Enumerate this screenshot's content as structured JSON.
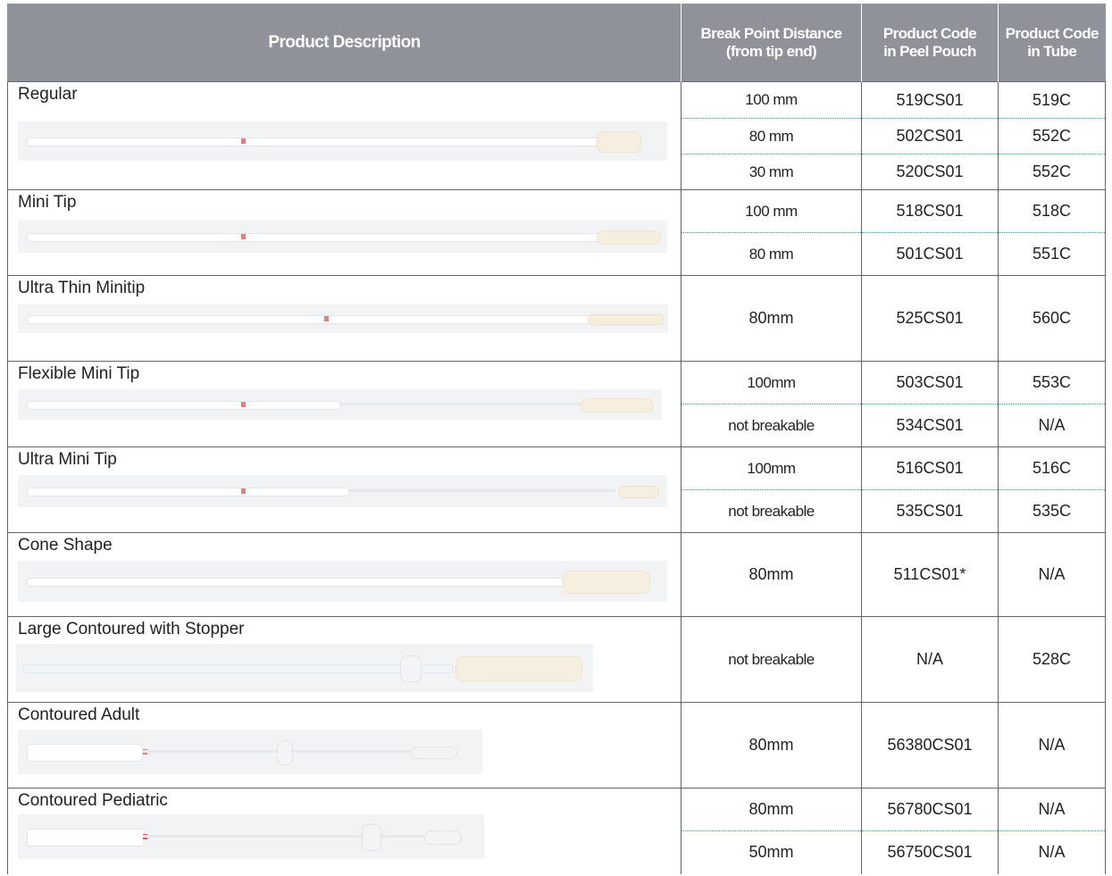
{
  "headers": {
    "description": "Product Description",
    "break_point": [
      "Break Point Distance",
      "(from tip end)"
    ],
    "peel_pouch": [
      "Product Code",
      "in Peel Pouch"
    ],
    "tube": [
      "Product Code",
      "in Tube"
    ]
  },
  "products": [
    {
      "name": "Regular",
      "rows": [
        {
          "break_point": "100 mm",
          "pouch": "519CS01",
          "tube": "519C"
        },
        {
          "break_point": "80 mm",
          "pouch": "502CS01",
          "tube": "552C"
        },
        {
          "break_point": "30 mm",
          "pouch": "520CS01",
          "tube": "552C"
        }
      ]
    },
    {
      "name": "Mini Tip",
      "rows": [
        {
          "break_point": "100 mm",
          "pouch": "518CS01",
          "tube": "518C"
        },
        {
          "break_point": "80 mm",
          "pouch": "501CS01",
          "tube": "551C"
        }
      ]
    },
    {
      "name": "Ultra Thin Minitip",
      "rows": [
        {
          "break_point": "80mm",
          "pouch": "525CS01",
          "tube": "560C"
        }
      ]
    },
    {
      "name": "Flexible Mini Tip",
      "rows": [
        {
          "break_point": "100mm",
          "pouch": "503CS01",
          "tube": "553C"
        },
        {
          "break_point": "not breakable",
          "pouch": "534CS01",
          "tube": "N/A"
        }
      ]
    },
    {
      "name": "Ultra Mini Tip",
      "rows": [
        {
          "break_point": "100mm",
          "pouch": "516CS01",
          "tube": "516C"
        },
        {
          "break_point": "not breakable",
          "pouch": "535CS01",
          "tube": "535C"
        }
      ]
    },
    {
      "name": "Cone Shape",
      "rows": [
        {
          "break_point": "80mm",
          "pouch": "511CS01*",
          "tube": "N/A"
        }
      ]
    },
    {
      "name": "Large Contoured with Stopper",
      "rows": [
        {
          "break_point": "not breakable",
          "pouch": "N/A",
          "tube": "528C"
        }
      ]
    },
    {
      "name": "Contoured  Adult",
      "rows": [
        {
          "break_point": "80mm",
          "pouch": "56380CS01",
          "tube": "N/A"
        }
      ]
    },
    {
      "name": "Contoured Pediatric",
      "rows": [
        {
          "break_point": "80mm",
          "pouch": "56780CS01",
          "tube": "N/A"
        },
        {
          "break_point": "50mm",
          "pouch": "56750CS01",
          "tube": "N/A"
        }
      ]
    }
  ]
}
